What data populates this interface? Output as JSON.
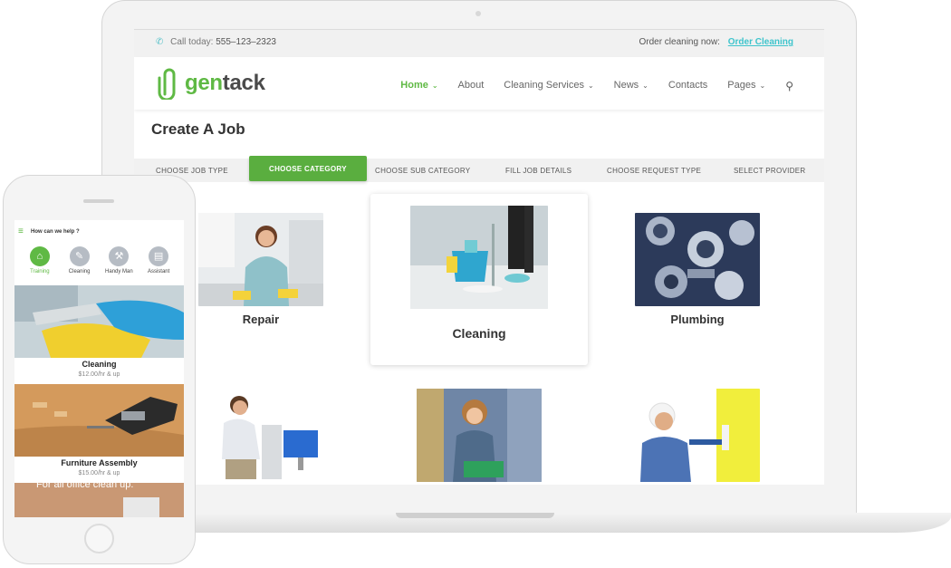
{
  "laptop": {
    "topbar": {
      "call_label": "Call today:",
      "phone": "555–123–2323",
      "order_label": "Order cleaning now:",
      "order_link": "Order Cleaning"
    },
    "logo": {
      "prefix": "gen",
      "suffix": "tack"
    },
    "nav": {
      "items": [
        "Home",
        "About",
        "Cleaning Services",
        "News",
        "Contacts",
        "Pages"
      ],
      "active": "Home"
    },
    "page_title": "Create A Job",
    "steps": [
      "CHOOSE JOB TYPE",
      "CHOOSE CATEGORY",
      "CHOOSE SUB CATEGORY",
      "FILL JOB DETAILS",
      "CHOOSE REQUEST TYPE",
      "SELECT PROVIDER"
    ],
    "active_step": "CHOOSE CATEGORY",
    "categories": [
      "Repair",
      "Cleaning",
      "Plumbing"
    ],
    "selected_category": "Cleaning"
  },
  "phone": {
    "help_text": "How can we help ?",
    "categories": [
      "Training",
      "Cleaning",
      "Handy Man",
      "Assistant"
    ],
    "active_category": "Training",
    "services": [
      {
        "name": "Cleaning",
        "price": "$12.00/hr & up"
      },
      {
        "name": "Furniture Assembly",
        "price": "$15.00/hr & up"
      }
    ],
    "overlay_text": "For all office clean up."
  },
  "colors": {
    "brand_green": "#5fb944",
    "accent_teal": "#3ec4cc",
    "step_active": "#5aae3f"
  }
}
